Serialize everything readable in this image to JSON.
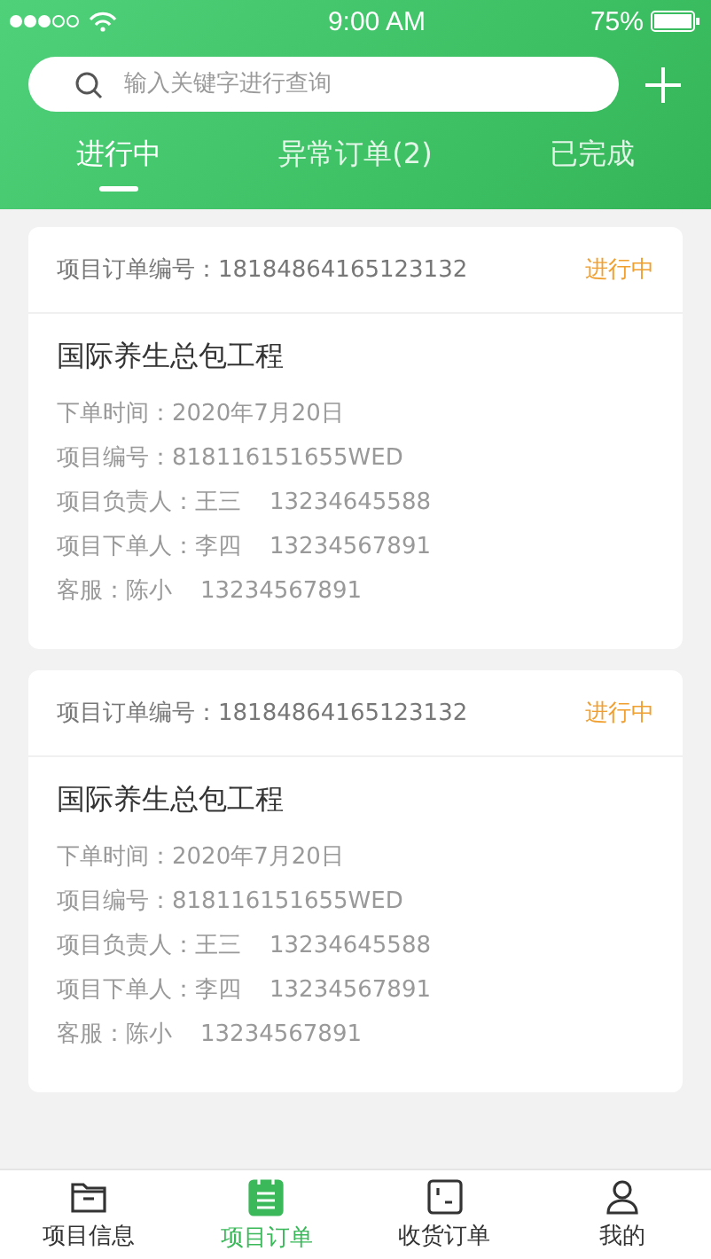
{
  "status_bar": {
    "time": "9:00 AM",
    "battery": "75%"
  },
  "search": {
    "placeholder": "输入关键字进行查询"
  },
  "tabs": [
    {
      "label": "进行中",
      "selected": true
    },
    {
      "label": "异常订单(2)",
      "selected": false
    },
    {
      "label": "已完成",
      "selected": false
    }
  ],
  "orders": [
    {
      "order_no": "项目订单编号：18184864165123132",
      "status": "进行中",
      "title": "国际养生总包工程",
      "rows": [
        {
          "text": "下单时间：2020年7月20日"
        },
        {
          "text": "项目编号：818116151655WED"
        },
        {
          "text": "项目负责人：王三",
          "phone": "13234645588"
        },
        {
          "text": "项目下单人：李四",
          "phone": "13234567891"
        },
        {
          "text": "客服：陈小",
          "phone": "13234567891"
        }
      ]
    },
    {
      "order_no": "项目订单编号：18184864165123132",
      "status": "进行中",
      "title": "国际养生总包工程",
      "rows": [
        {
          "text": "下单时间：2020年7月20日"
        },
        {
          "text": "项目编号：818116151655WED"
        },
        {
          "text": "项目负责人：王三",
          "phone": "13234645588"
        },
        {
          "text": "项目下单人：李四",
          "phone": "13234567891"
        },
        {
          "text": "客服：陈小",
          "phone": "13234567891"
        }
      ]
    }
  ],
  "nav": [
    {
      "kind": "folder",
      "label": "项目信息",
      "selected": false
    },
    {
      "kind": "notepad",
      "label": "项目订单",
      "selected": true
    },
    {
      "kind": "box",
      "label": "收货订单",
      "selected": false
    },
    {
      "kind": "person",
      "label": "我的",
      "selected": false
    }
  ]
}
